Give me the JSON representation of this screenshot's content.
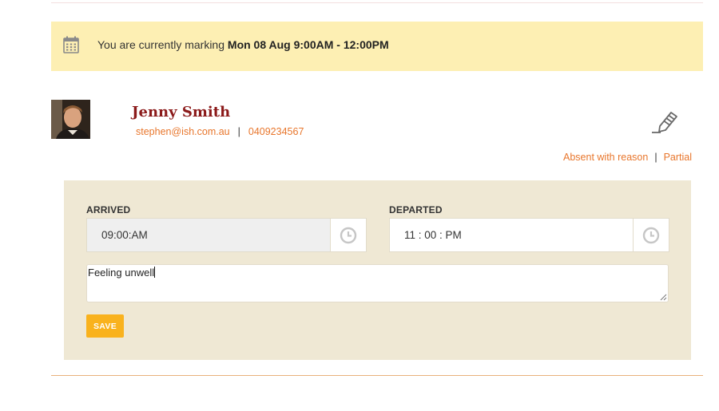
{
  "banner": {
    "prefix": "You are currently marking ",
    "session": "Mon 08 Aug 9:00AM - 12:00PM"
  },
  "student": {
    "name": "Jenny Smith",
    "email": "stephen@ish.com.au",
    "separator": "|",
    "phone": "0409234567"
  },
  "status_links": {
    "absent": "Absent with reason",
    "separator": "|",
    "partial": "Partial"
  },
  "form": {
    "arrived_label": "ARRIVED",
    "arrived_value": "09:00:AM",
    "departed_label": "DEPARTED",
    "departed_value": "11 : 00 : PM",
    "note_value": "Feeling unwell",
    "save_label": "SAVE"
  },
  "colors": {
    "banner_bg": "#fdefb3",
    "panel_bg": "#efe8d4",
    "name": "#8b1a1a",
    "link": "#e8762c",
    "save_button": "#f9b21d"
  },
  "icons": [
    "calendar-icon",
    "edit-pencil-icon",
    "clock-icon",
    "resize-grip-icon"
  ]
}
